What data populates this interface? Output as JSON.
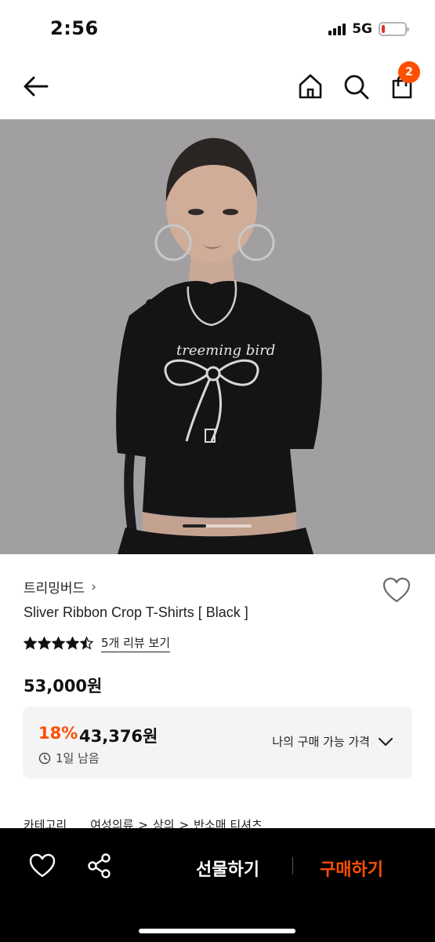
{
  "status_bar": {
    "time": "2:56",
    "network": "5G",
    "battery_level": 0.15,
    "battery_color": "#e0302a"
  },
  "nav": {
    "back_icon": "arrow-left-icon",
    "home_icon": "home-icon",
    "search_icon": "search-icon",
    "cart_icon": "shopping-bag-icon",
    "cart_count": "2",
    "badge_color": "#ff4f00"
  },
  "product": {
    "brand": "트리밍버드",
    "brand_chevron": "›",
    "name": "Sliver Ribbon Crop T-Shirts [ Black ]",
    "rating": 4.5,
    "review_link": "5개 리뷰 보기",
    "price": "53,000원",
    "image_page": 1,
    "image_count": 3
  },
  "discount": {
    "rate": "18%",
    "price": "43,376원",
    "timer": "1일 남음",
    "my_price_label": "나의 구매 가능 가격"
  },
  "category": {
    "label": "카테고리",
    "path": [
      "여성의류",
      "상의",
      "반소매 티셔츠"
    ],
    "separator": ">"
  },
  "bottom_bar": {
    "gift_label": "선물하기",
    "buy_label": "구매하기",
    "accent_color": "#ff4f00"
  }
}
